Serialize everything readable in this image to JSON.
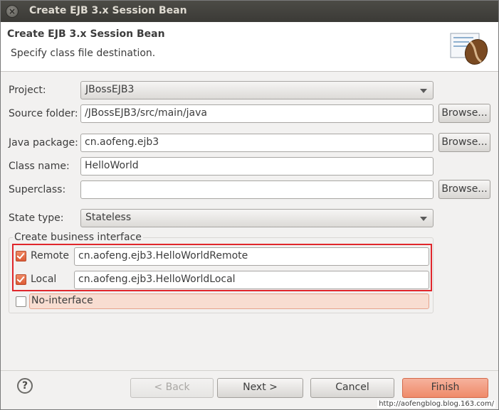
{
  "window": {
    "title": "Create EJB 3.x Session Bean",
    "close_glyph": "×"
  },
  "banner": {
    "title": "Create EJB 3.x Session Bean",
    "subtitle": "Specify class file destination.",
    "icon": "coffee-bean-icon"
  },
  "form": {
    "project_label": "Project:",
    "project_value": "JBossEJB3",
    "source_folder_label": "Source folder:",
    "source_folder_value": "/JBossEJB3/src/main/java",
    "java_package_label": "Java package:",
    "java_package_value": "cn.aofeng.ejb3",
    "class_name_label": "Class name:",
    "class_name_value": "HelloWorld",
    "superclass_label": "Superclass:",
    "superclass_value": "",
    "state_type_label": "State type:",
    "state_type_value": "Stateless",
    "browse_label": "Browse..."
  },
  "business_interface": {
    "legend": "Create business interface",
    "remote_label": "Remote",
    "remote_checked": true,
    "remote_value": "cn.aofeng.ejb3.HelloWorldRemote",
    "local_label": "Local",
    "local_checked": true,
    "local_value": "cn.aofeng.ejb3.HelloWorldLocal",
    "no_interface_label": "No-interface",
    "no_interface_checked": false
  },
  "buttons": {
    "help": "?",
    "back": "< Back",
    "next": "Next >",
    "cancel": "Cancel",
    "finish": "Finish"
  },
  "watermark": "http://aofengblog.blog.163.com/",
  "colors": {
    "accent": "#ef8a69",
    "highlight_border": "#e0262b",
    "titlebar": "#3b3a36"
  }
}
